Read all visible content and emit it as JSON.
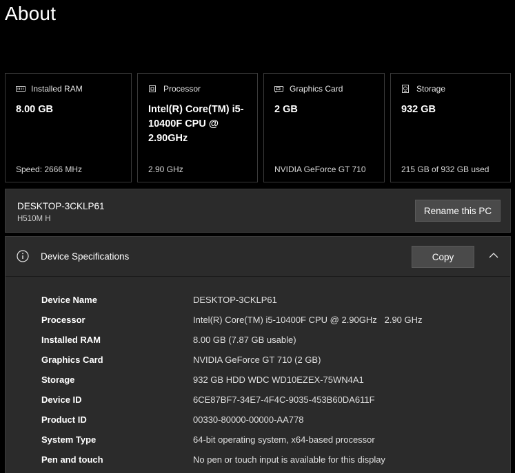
{
  "page": {
    "title": "About"
  },
  "cards": [
    {
      "icon": "ram-icon",
      "label": "Installed RAM",
      "value": "8.00 GB",
      "foot": "Speed: 2666 MHz"
    },
    {
      "icon": "processor-icon",
      "label": "Processor",
      "value": "Intel(R) Core(TM) i5-10400F CPU @ 2.90GHz",
      "foot": "2.90 GHz"
    },
    {
      "icon": "graphics-card-icon",
      "label": "Graphics Card",
      "value": "2 GB",
      "foot": "NVIDIA GeForce GT 710"
    },
    {
      "icon": "storage-icon",
      "label": "Storage",
      "value": "932 GB",
      "foot": "215 GB of 932 GB used"
    }
  ],
  "pc": {
    "name": "DESKTOP-3CKLP61",
    "model": "H510M H",
    "rename_label": "Rename this PC"
  },
  "specs": {
    "title": "Device Specifications",
    "copy_label": "Copy",
    "header_icon": "info-icon",
    "toggle_icon": "chevron-up-icon",
    "rows": [
      {
        "key": "Device Name",
        "value": "DESKTOP-3CKLP61"
      },
      {
        "key": "Processor",
        "value": "Intel(R) Core(TM) i5-10400F CPU @ 2.90GHz   2.90 GHz"
      },
      {
        "key": "Installed RAM",
        "value": "8.00 GB (7.87 GB usable)"
      },
      {
        "key": "Graphics Card",
        "value": "NVIDIA GeForce GT 710 (2 GB)"
      },
      {
        "key": "Storage",
        "value": "932 GB HDD WDC WD10EZEX-75WN4A1"
      },
      {
        "key": "Device ID",
        "value": "6CE87BF7-34E7-4F4C-9035-453B60DA611F"
      },
      {
        "key": "Product ID",
        "value": "00330-80000-00000-AA778"
      },
      {
        "key": "System Type",
        "value": "64-bit operating system, x64-based processor"
      },
      {
        "key": "Pen and touch",
        "value": "No pen or touch input is available for this display"
      }
    ]
  }
}
